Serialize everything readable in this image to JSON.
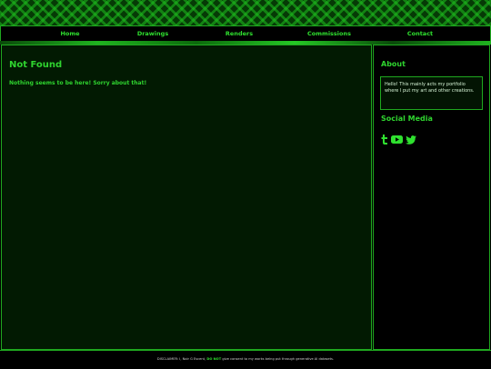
{
  "nav": {
    "items": [
      {
        "label": "Home"
      },
      {
        "label": "Drawings"
      },
      {
        "label": "Renders"
      },
      {
        "label": "Commissions"
      },
      {
        "label": "Contact"
      }
    ]
  },
  "main": {
    "title": "Not Found",
    "message": "Nothing seems to be here! Sorry about that!"
  },
  "sidebar": {
    "about_heading": "About",
    "about_text": "Hello! This mainly acts my portfolio where I put my art and other creations.",
    "social_heading": "Social Media",
    "social_icons": [
      "tumblr-icon",
      "youtube-icon",
      "twitter-icon"
    ]
  },
  "footer": {
    "prefix": "DISCLAIMER: I, Noir G Escent,",
    "emphasis": "DO NOT",
    "suffix": "give consent to my works being put through generative AI datasets."
  },
  "colors": {
    "accent": "#2fe02f",
    "border": "#1fa81f",
    "main_bg": "#021a02",
    "page_bg": "#000000"
  }
}
